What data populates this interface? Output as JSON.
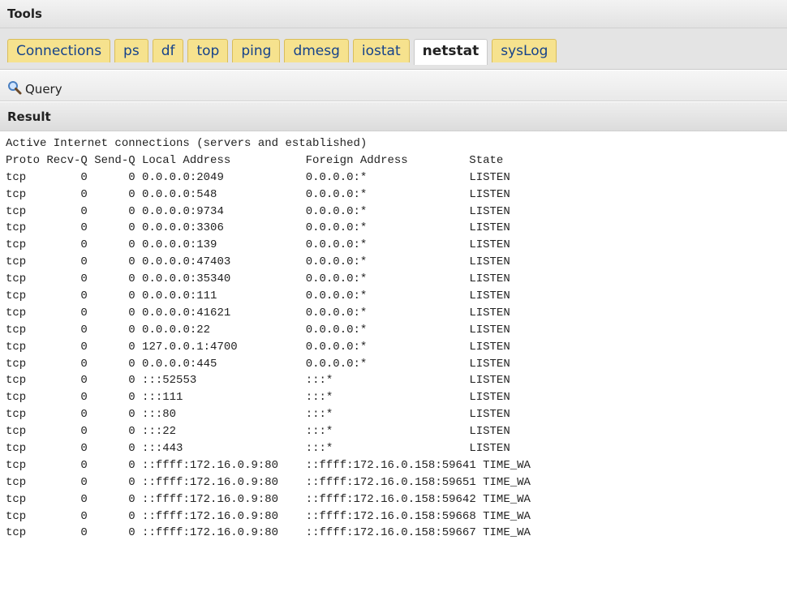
{
  "panel": {
    "title": "Tools"
  },
  "tabs": [
    {
      "label": "Connections",
      "active": false
    },
    {
      "label": "ps",
      "active": false
    },
    {
      "label": "df",
      "active": false
    },
    {
      "label": "top",
      "active": false
    },
    {
      "label": "ping",
      "active": false
    },
    {
      "label": "dmesg",
      "active": false
    },
    {
      "label": "iostat",
      "active": false
    },
    {
      "label": "netstat",
      "active": true
    },
    {
      "label": "sysLog",
      "active": false
    }
  ],
  "toolbar": {
    "query_label": "Query",
    "query_icon": "magnifier-icon"
  },
  "result": {
    "title": "Result",
    "heading": "Active Internet connections (servers and established)",
    "columns_line": "Proto Recv-Q Send-Q Local Address           Foreign Address         State",
    "rows": [
      {
        "proto": "tcp",
        "recvq": "0",
        "sendq": "0",
        "local": "0.0.0.0:2049",
        "foreign": "0.0.0.0:*",
        "state": "LISTEN"
      },
      {
        "proto": "tcp",
        "recvq": "0",
        "sendq": "0",
        "local": "0.0.0.0:548",
        "foreign": "0.0.0.0:*",
        "state": "LISTEN"
      },
      {
        "proto": "tcp",
        "recvq": "0",
        "sendq": "0",
        "local": "0.0.0.0:9734",
        "foreign": "0.0.0.0:*",
        "state": "LISTEN"
      },
      {
        "proto": "tcp",
        "recvq": "0",
        "sendq": "0",
        "local": "0.0.0.0:3306",
        "foreign": "0.0.0.0:*",
        "state": "LISTEN"
      },
      {
        "proto": "tcp",
        "recvq": "0",
        "sendq": "0",
        "local": "0.0.0.0:139",
        "foreign": "0.0.0.0:*",
        "state": "LISTEN"
      },
      {
        "proto": "tcp",
        "recvq": "0",
        "sendq": "0",
        "local": "0.0.0.0:47403",
        "foreign": "0.0.0.0:*",
        "state": "LISTEN"
      },
      {
        "proto": "tcp",
        "recvq": "0",
        "sendq": "0",
        "local": "0.0.0.0:35340",
        "foreign": "0.0.0.0:*",
        "state": "LISTEN"
      },
      {
        "proto": "tcp",
        "recvq": "0",
        "sendq": "0",
        "local": "0.0.0.0:111",
        "foreign": "0.0.0.0:*",
        "state": "LISTEN"
      },
      {
        "proto": "tcp",
        "recvq": "0",
        "sendq": "0",
        "local": "0.0.0.0:41621",
        "foreign": "0.0.0.0:*",
        "state": "LISTEN"
      },
      {
        "proto": "tcp",
        "recvq": "0",
        "sendq": "0",
        "local": "0.0.0.0:22",
        "foreign": "0.0.0.0:*",
        "state": "LISTEN"
      },
      {
        "proto": "tcp",
        "recvq": "0",
        "sendq": "0",
        "local": "127.0.0.1:4700",
        "foreign": "0.0.0.0:*",
        "state": "LISTEN"
      },
      {
        "proto": "tcp",
        "recvq": "0",
        "sendq": "0",
        "local": "0.0.0.0:445",
        "foreign": "0.0.0.0:*",
        "state": "LISTEN"
      },
      {
        "proto": "tcp",
        "recvq": "0",
        "sendq": "0",
        "local": ":::52553",
        "foreign": ":::*",
        "state": "LISTEN"
      },
      {
        "proto": "tcp",
        "recvq": "0",
        "sendq": "0",
        "local": ":::111",
        "foreign": ":::*",
        "state": "LISTEN"
      },
      {
        "proto": "tcp",
        "recvq": "0",
        "sendq": "0",
        "local": ":::80",
        "foreign": ":::*",
        "state": "LISTEN"
      },
      {
        "proto": "tcp",
        "recvq": "0",
        "sendq": "0",
        "local": ":::22",
        "foreign": ":::*",
        "state": "LISTEN"
      },
      {
        "proto": "tcp",
        "recvq": "0",
        "sendq": "0",
        "local": ":::443",
        "foreign": ":::*",
        "state": "LISTEN"
      },
      {
        "proto": "tcp",
        "recvq": "0",
        "sendq": "0",
        "local": "::ffff:172.16.0.9:80",
        "foreign": "::ffff:172.16.0.158:59641",
        "state": "TIME_WA"
      },
      {
        "proto": "tcp",
        "recvq": "0",
        "sendq": "0",
        "local": "::ffff:172.16.0.9:80",
        "foreign": "::ffff:172.16.0.158:59651",
        "state": "TIME_WA"
      },
      {
        "proto": "tcp",
        "recvq": "0",
        "sendq": "0",
        "local": "::ffff:172.16.0.9:80",
        "foreign": "::ffff:172.16.0.158:59642",
        "state": "TIME_WA"
      },
      {
        "proto": "tcp",
        "recvq": "0",
        "sendq": "0",
        "local": "::ffff:172.16.0.9:80",
        "foreign": "::ffff:172.16.0.158:59668",
        "state": "TIME_WA"
      },
      {
        "proto": "tcp",
        "recvq": "0",
        "sendq": "0",
        "local": "::ffff:172.16.0.9:80",
        "foreign": "::ffff:172.16.0.158:59667",
        "state": "TIME_WA"
      }
    ]
  }
}
